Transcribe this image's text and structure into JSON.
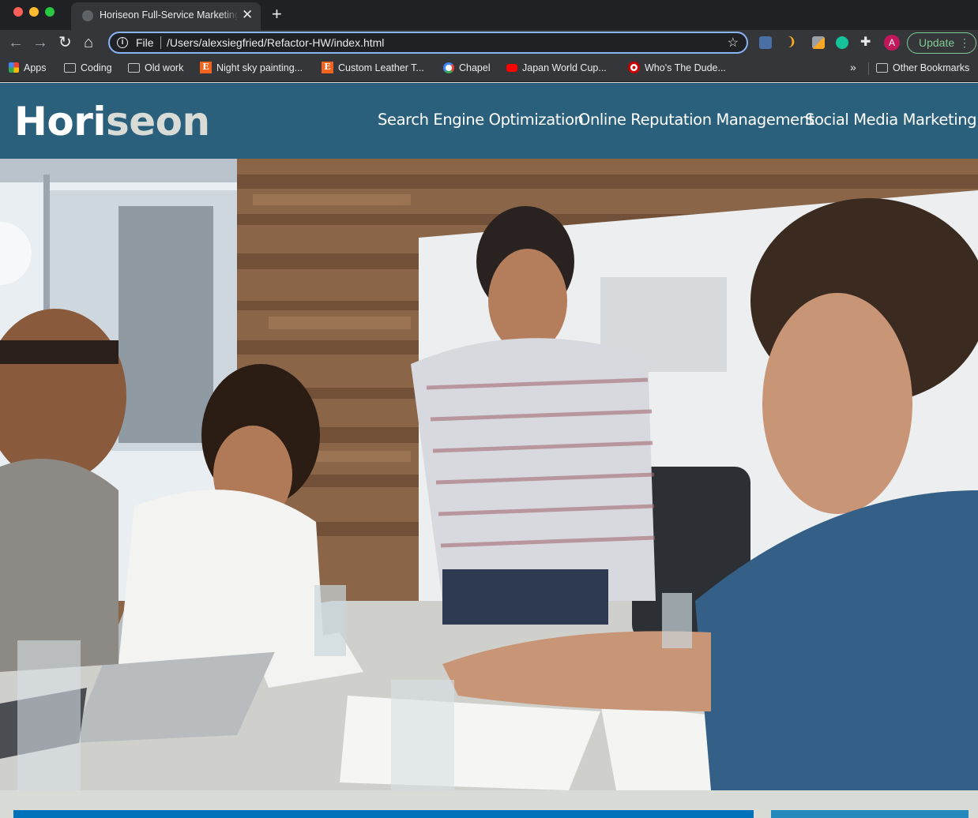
{
  "browser": {
    "tab": {
      "title": "Horiseon Full-Service Marketing"
    },
    "omnibox": {
      "scheme": "File",
      "url": "/Users/alexsiegfried/Refactor-HW/index.html"
    },
    "update_label": "Update",
    "bookmarks": [
      {
        "label": "Apps",
        "icon": "apps-icon"
      },
      {
        "label": "Coding",
        "icon": "folder-icon"
      },
      {
        "label": "Old work",
        "icon": "folder-icon"
      },
      {
        "label": "Night sky painting...",
        "icon": "etsy-icon"
      },
      {
        "label": "Custom Leather T...",
        "icon": "etsy-icon"
      },
      {
        "label": "Chapel",
        "icon": "google-icon"
      },
      {
        "label": "Japan World Cup...",
        "icon": "youtube-icon"
      },
      {
        "label": "Who's The Dude...",
        "icon": "target-icon"
      }
    ],
    "other_bookmarks": "Other Bookmarks",
    "avatar_initial": "A"
  },
  "site": {
    "logo": {
      "main": "Hori",
      "accent": "seon"
    },
    "nav": [
      "Search Engine Optimization",
      "Online Reputation Management",
      "Social Media Marketing"
    ]
  },
  "colors": {
    "header_bg": "#2a607c",
    "page_bg": "#d9dcd6",
    "content_accent": "#0072bb"
  }
}
